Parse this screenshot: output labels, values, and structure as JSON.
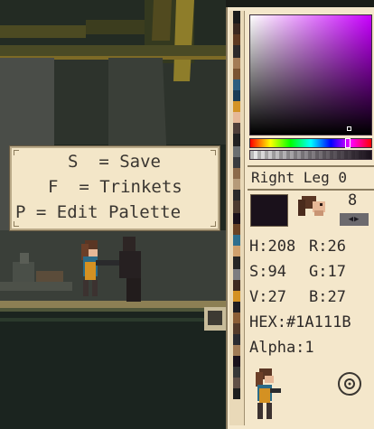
{
  "hints": {
    "save": "S  = Save",
    "trinkets": "F  = Trinkets",
    "edit_palette": "P = Edit Palette"
  },
  "editor": {
    "part_label": "Right Leg 0",
    "count": "8",
    "arrow_buttons": "◀▶",
    "hsv_rgb": {
      "h": "H:208",
      "r": "R:26",
      "s": "S:94",
      "g": "G:17",
      "v": "V:27",
      "b": "B:27"
    },
    "hex": "HEX:#1A111B",
    "alpha": "Alpha:1",
    "colors": {
      "selected": "#1A111B",
      "gradient_hue": "#c800ff"
    }
  },
  "icons": {
    "target": "target-icon",
    "part_preview": "character-head-icon"
  }
}
